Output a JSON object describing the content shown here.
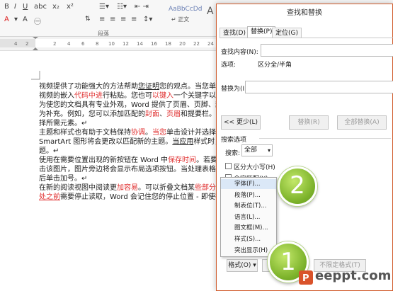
{
  "ribbon": {
    "styles": [
      {
        "preview": "AaBbCcDd",
        "name": "↵ 正文"
      },
      {
        "preview": "A  B",
        "name": ""
      }
    ],
    "group_label": "段落"
  },
  "document": {
    "lines": [
      [
        {
          "t": "视频提供了功能强大的方法帮助"
        },
        {
          "t": "您证明",
          "c": "ul"
        },
        {
          "t": "您的观点。当您单击联"
        }
      ],
      [
        {
          "t": "视频的嵌入"
        },
        {
          "t": "代码中进",
          "c": "red"
        },
        {
          "t": "行粘贴。您也可"
        },
        {
          "t": "以键入",
          "c": "red"
        },
        {
          "t": "一个关键字以联机"
        }
      ],
      [
        {
          "t": "为使您的文档具有专业外观，Word 提供了页眉、页脚、封面和"
        }
      ],
      [
        {
          "t": "为补充。例如，您可以添加匹配的"
        },
        {
          "t": "封面",
          "c": "red"
        },
        {
          "t": "、"
        },
        {
          "t": "页眉",
          "c": "red"
        },
        {
          "t": "和提要栏。单击"
        }
      ],
      [
        {
          "t": "择所需元素。↵"
        }
      ],
      [
        {
          "t": "主题和样式也有助于文档保持"
        },
        {
          "t": "协调",
          "c": "red"
        },
        {
          "t": "。"
        },
        {
          "t": "当您",
          "c": "red"
        },
        {
          "t": "单击设计并选择"
        }
      ],
      [
        {
          "t": "SmartArt 图形将会更改以匹配新的主题。"
        },
        {
          "t": "当应用",
          "c": "ul"
        },
        {
          "t": "样式时，您的"
        }
      ],
      [
        {
          "t": "题。↵"
        }
      ],
      [
        {
          "t": "使用在需要位置出现的新按钮在 Word 中"
        },
        {
          "t": "保存时间",
          "c": "red"
        },
        {
          "t": "。若要更改"
        }
      ],
      [
        {
          "t": "击该图片，图片旁边将会显示布局选项按钮。当处理表格时，"
        }
      ],
      [
        {
          "t": "后单击加号。↵"
        }
      ],
      [
        {
          "t": "在新的阅读视图中阅读更"
        },
        {
          "t": "加容易",
          "c": "red"
        },
        {
          "t": "。可以折叠文档某"
        },
        {
          "t": "些部分并关",
          "c": "red"
        }
      ],
      [
        {
          "t": "处之前",
          "c": "red ul"
        },
        {
          "t": "需要停止读取，Word 会记住您的停止位置 - 即使在另"
        }
      ]
    ]
  },
  "dialog": {
    "title": "查找和替换",
    "tabs": [
      "查找(D)",
      "替换(P)",
      "定位(G)"
    ],
    "find_label": "查找内容(N):",
    "find_value": "",
    "options_label": "选项:",
    "options_value": "区分全/半角",
    "replace_label": "替换为(I):",
    "replace_value": "",
    "less_button": "<< 更少(L)",
    "replace_button": "替换(R)",
    "replace_all_button": "全部替换(A)",
    "search_options_label": "搜索选项",
    "search_label": "搜索:",
    "search_value": "全部",
    "match_case_label": "区分大小写(H)",
    "whole_word_label": "全字匹配(Y)",
    "bottom_label": "查",
    "format_button": "格式(O) ▾",
    "no_format_button": "不限定格式(T)"
  },
  "format_menu": {
    "items": [
      "字体(F)...",
      "段落(P)...",
      "制表位(T)...",
      "语言(L)...",
      "图文框(M)...",
      "样式(S)...",
      "突出显示(H)"
    ],
    "highlighted_index": 0
  },
  "annotations": {
    "one": "1",
    "two": "2"
  },
  "watermark": {
    "text": "eeppt.com",
    "icon": "powerpoint-p-icon"
  },
  "colors": {
    "accent_red": "#e03030",
    "dialog_border": "#d05a2a",
    "circle_green": "#7db32b",
    "menu_highlight": "#dbe8f7",
    "watermark_orange": "#d9532b"
  }
}
